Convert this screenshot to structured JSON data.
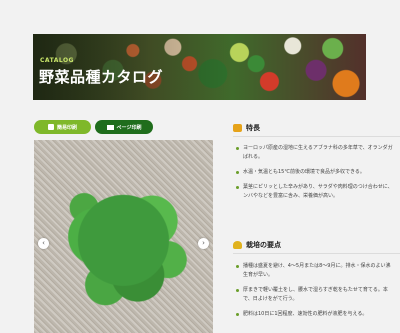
{
  "hero": {
    "tag": "CATALOG",
    "title": "野菜品種カタログ"
  },
  "actions": {
    "simple_print": "簡易印刷",
    "page_print": "ページ印刷"
  },
  "photo": {
    "prev_symbol": "‹",
    "next_symbol": "›"
  },
  "features": {
    "heading": "特長",
    "items": [
      {
        "line1": "ヨーロッパ原産の湿地に生えるアブラナ科の多年草で、オランダガ",
        "line2": "ばれる。"
      },
      {
        "line1": "水温・気温とも15℃前後の環境で良品が多収できる。",
        "line2": ""
      },
      {
        "line1": "葉茎にピリッとした辛みがあり、サラダや肉料理のつけ合わせに、",
        "line2": "ンバやなどを豊富に含み、栄養価が高い。"
      }
    ]
  },
  "cultivation": {
    "heading": "栽培の要点",
    "items": [
      {
        "line1": "播種は盛夏を避け、4〜5月または8〜9月に。排水・保水のよい沸",
        "line2": "生育が早い。"
      },
      {
        "line1": "厚まきで軽い覆土をし、腰水で湿らすぎ乾をもたせて育てる。本",
        "line2": "で、日よけをがて行う。"
      },
      {
        "line1": "肥料は10日に1回程度、速効性の肥料が液肥を与える。",
        "line2": ""
      }
    ]
  }
}
